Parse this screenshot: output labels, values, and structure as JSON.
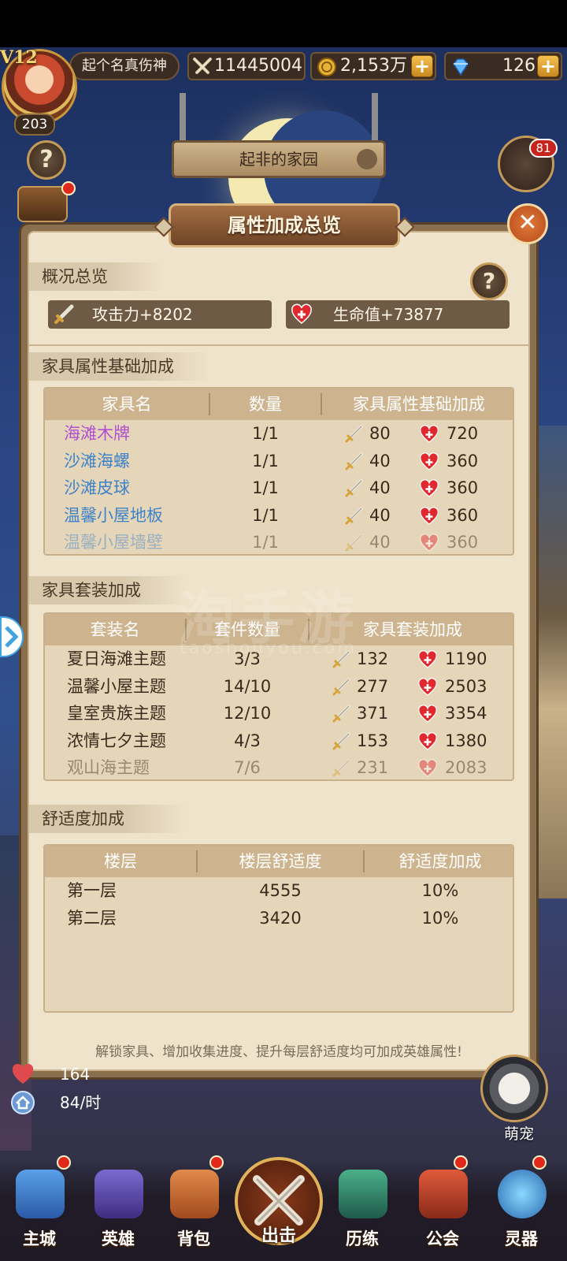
{
  "topbar": {
    "vip": "V12",
    "level": "203",
    "player_name": "起个名真伤神",
    "power": "11445004",
    "gold": "2,153万",
    "gems": "126"
  },
  "home_sign": "起非的家园",
  "chat_badge": "81",
  "panel": {
    "title": "属性加成总览",
    "overview": {
      "heading": "概况总览",
      "attack": "攻击力+8202",
      "hp": "生命值+73877"
    },
    "base_bonus": {
      "heading": "家具属性基础加成",
      "columns": [
        "家具名",
        "数量",
        "家具属性基础加成"
      ],
      "rows": [
        {
          "name": "海滩木牌",
          "count": "1/1",
          "atk": "80",
          "hp": "720",
          "color": "#b04fcf"
        },
        {
          "name": "沙滩海螺",
          "count": "1/1",
          "atk": "40",
          "hp": "360",
          "color": "#3f82c7"
        },
        {
          "name": "沙滩皮球",
          "count": "1/1",
          "atk": "40",
          "hp": "360",
          "color": "#3f82c7"
        },
        {
          "name": "温馨小屋地板",
          "count": "1/1",
          "atk": "40",
          "hp": "360",
          "color": "#3f82c7"
        },
        {
          "name": "温馨小屋墙壁",
          "count": "1/1",
          "atk": "40",
          "hp": "360",
          "color": "#3f82c7"
        }
      ]
    },
    "set_bonus": {
      "heading": "家具套装加成",
      "columns": [
        "套装名",
        "套件数量",
        "家具套装加成"
      ],
      "rows": [
        {
          "name": "夏日海滩主题",
          "count": "3/3",
          "atk": "132",
          "hp": "1190"
        },
        {
          "name": "温馨小屋主题",
          "count": "14/10",
          "atk": "277",
          "hp": "2503"
        },
        {
          "name": "皇室贵族主题",
          "count": "12/10",
          "atk": "371",
          "hp": "3354"
        },
        {
          "name": "浓情七夕主题",
          "count": "4/3",
          "atk": "153",
          "hp": "1380"
        },
        {
          "name": "观山海主题",
          "count": "7/6",
          "atk": "231",
          "hp": "2083"
        }
      ]
    },
    "comfort": {
      "heading": "舒适度加成",
      "columns": [
        "楼层",
        "楼层舒适度",
        "舒适度加成"
      ],
      "rows": [
        {
          "floor": "第一层",
          "comfort": "4555",
          "bonus": "10%"
        },
        {
          "floor": "第二层",
          "comfort": "3420",
          "bonus": "10%"
        }
      ]
    },
    "footer": "解锁家具、增加收集进度、提升每层舒适度均可加成英雄属性!"
  },
  "hud": {
    "hearts": "164",
    "rate": "84/时",
    "pet_label": "萌宠"
  },
  "nav": [
    "主城",
    "英雄",
    "背包",
    "出击",
    "历练",
    "公会",
    "灵器"
  ],
  "watermark": "淘手游",
  "watermark_sub": "taoshouyou.com",
  "colors": {
    "panel_bg": "#efe3cb",
    "header_brown": "#cdb48f",
    "accent_red": "#e0281c"
  }
}
